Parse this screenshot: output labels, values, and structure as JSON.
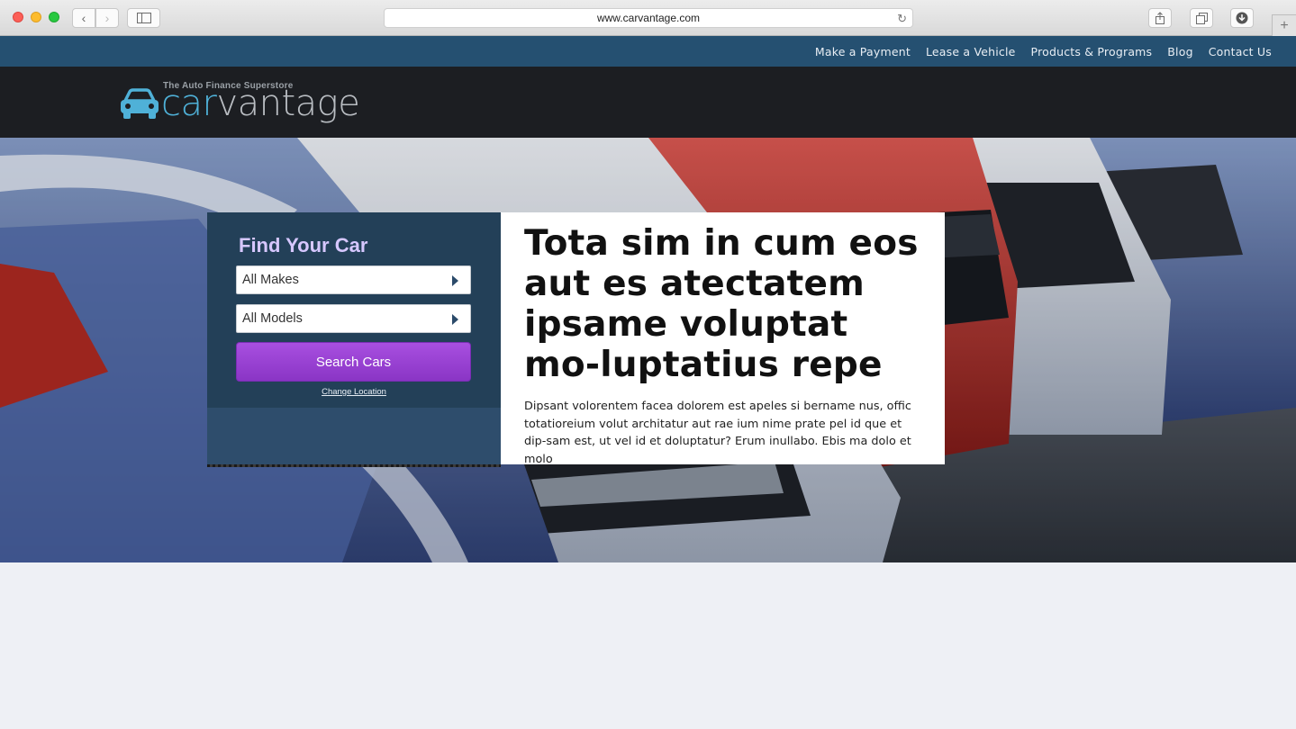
{
  "browser": {
    "url": "www.carvantage.com",
    "back_glyph": "‹",
    "forward_glyph": "›",
    "reload_glyph": "↻",
    "newtab_glyph": "+"
  },
  "topnav": {
    "items": [
      "Make a Payment",
      "Lease a Vehicle",
      "Products & Programs",
      "Blog",
      "Contact Us"
    ]
  },
  "logo": {
    "tagline": "The Auto Finance Superstore",
    "word_a": "car",
    "word_b": "vantage"
  },
  "finder": {
    "title": "Find Your Car",
    "makes_value": "All Makes",
    "models_value": "All Models",
    "search_label": "Search Cars",
    "change_location": "Change Location"
  },
  "hero_card": {
    "headline": "Tota sim in cum eos aut es atectatem ipsame voluptat mo-luptatius repe",
    "body": "Dipsant volorentem facea dolorem est apeles si bername nus, offic totatioreium volut architatur aut rae ium nime prate pel id que et dip-sam est, ut vel id et doluptatur? Erum inullabo. Ebis ma dolo et molo"
  },
  "colors": {
    "topnav_bg": "#255071",
    "logo_bg": "#1c1e22",
    "finder_bg": "#234058",
    "search_button": "#9a42d3",
    "finder_title": "#d6c7ff",
    "page_bg": "#eef0f5"
  },
  "icons": [
    "back-icon",
    "forward-icon",
    "sidebar-icon",
    "reload-icon",
    "share-icon",
    "tabs-icon",
    "download-icon",
    "plus-icon",
    "car-logo-icon",
    "caret-right-icon"
  ]
}
